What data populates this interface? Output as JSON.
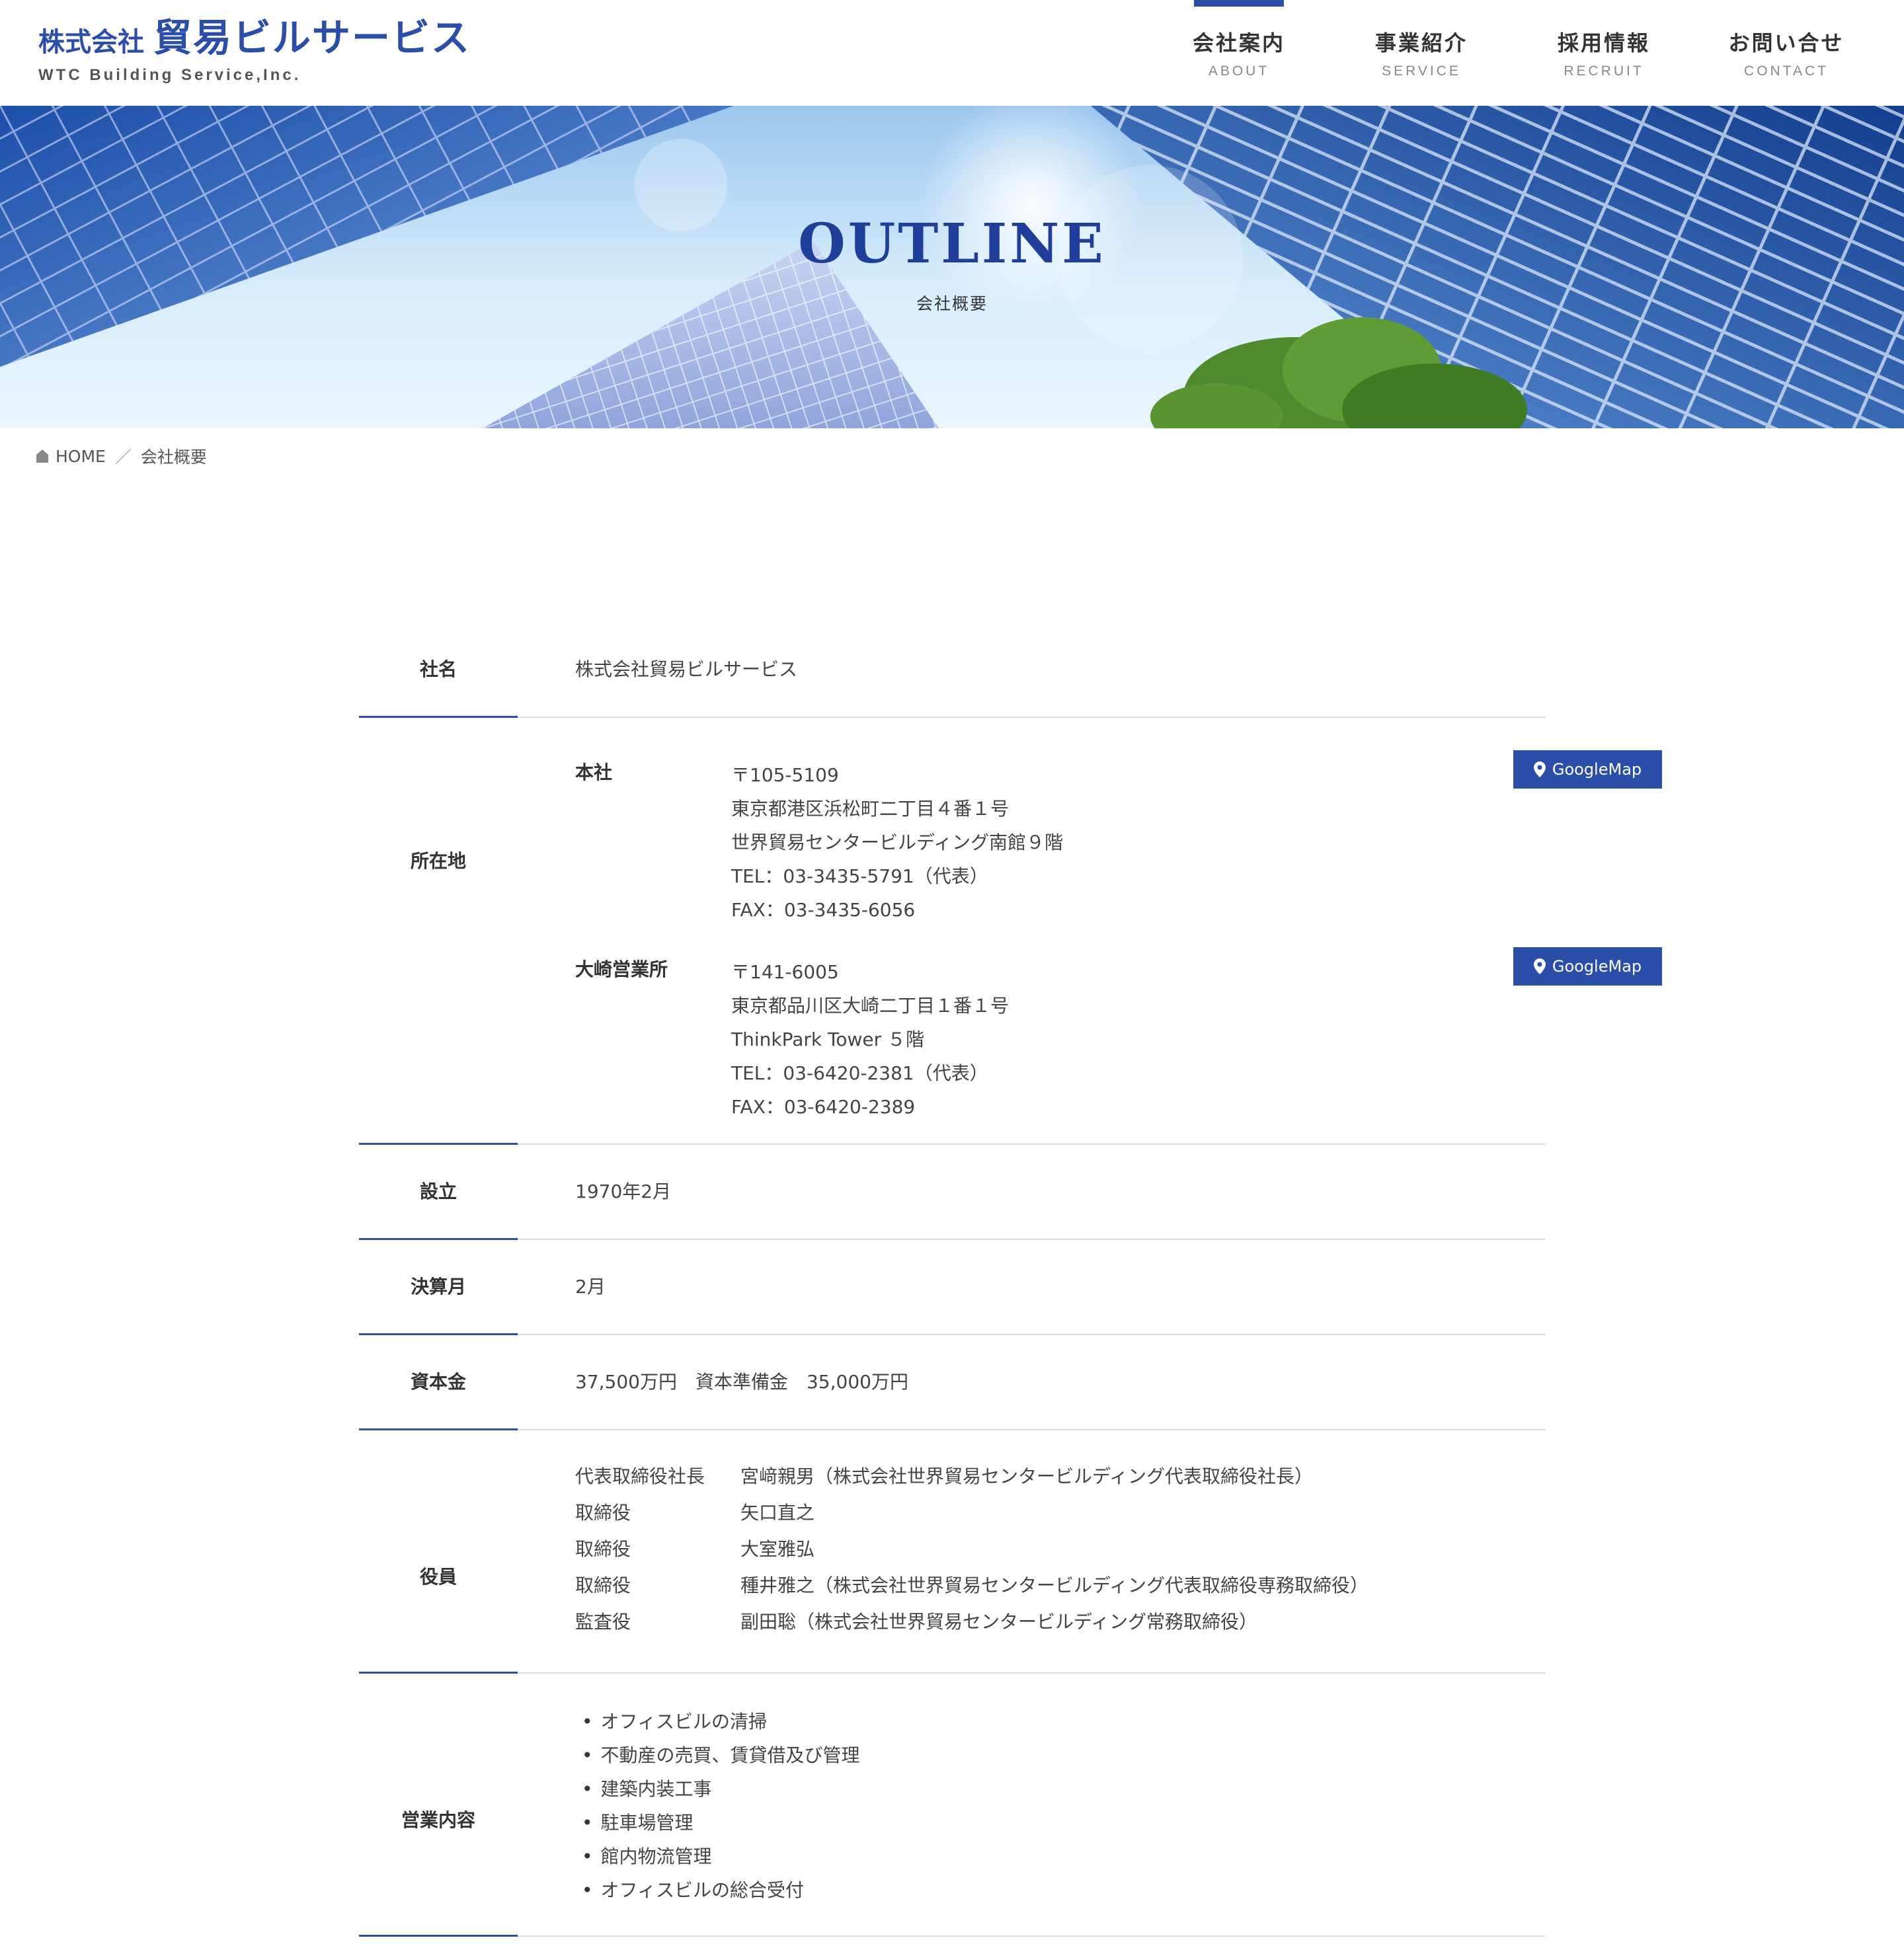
{
  "header": {
    "logo_prefix": "株式会社",
    "logo_name": "貿易ビルサービス",
    "logo_en": "WTC Building Service,Inc.",
    "brand_color": "#2b4ea8",
    "nav": [
      {
        "label": "会社案内",
        "sub": "ABOUT"
      },
      {
        "label": "事業紹介",
        "sub": "SERVICE"
      },
      {
        "label": "採用情報",
        "sub": "RECRUIT"
      },
      {
        "label": "お問い合せ",
        "sub": "CONTACT"
      }
    ]
  },
  "hero": {
    "title": "OUTLINE",
    "subtitle": "会社概要"
  },
  "breadcrumb": {
    "home": "HOME",
    "separator": "／",
    "current": "会社概要"
  },
  "company": {
    "name_label": "社名",
    "name": "株式会社貿易ビルサービス",
    "location_label": "所在地",
    "map_button": "GoogleMap",
    "offices": [
      {
        "name": "本社",
        "lines": [
          "〒105-5109",
          "東京都港区浜松町二丁目４番１号",
          "世界貿易センタービルディング南館９階",
          "TEL：03-3435-5791（代表）",
          "FAX：03-3435-6056"
        ]
      },
      {
        "name": "大崎営業所",
        "lines": [
          "〒141-6005",
          "東京都品川区大崎二丁目１番１号",
          "ThinkPark Tower ５階",
          "TEL：03-6420-2381（代表）",
          "FAX：03-6420-2389"
        ]
      }
    ],
    "founded_label": "設立",
    "founded": "1970年2月",
    "fiscal_label": "決算月",
    "fiscal": "2月",
    "capital_label": "資本金",
    "capital": "37,500万円　資本準備金　35,000万円",
    "officers_label": "役員",
    "officers": [
      {
        "role": "代表取締役社長",
        "name": "宮﨑親男（株式会社世界貿易センタービルディング代表取締役社長）"
      },
      {
        "role": "取締役",
        "name": "矢口直之"
      },
      {
        "role": "取締役",
        "name": "大室雅弘"
      },
      {
        "role": "取締役",
        "name": "種井雅之（株式会社世界貿易センタービルディング代表取締役専務取締役）"
      },
      {
        "role": "監査役",
        "name": "副田聡（株式会社世界貿易センタービルディング常務取締役）"
      }
    ],
    "business_label": "営業内容",
    "business": [
      "オフィスビルの清掃",
      "不動産の売買、賃貸借及び管理",
      "建築内装工事",
      "駐車場管理",
      "館内物流管理",
      "オフィスビルの総合受付"
    ]
  }
}
